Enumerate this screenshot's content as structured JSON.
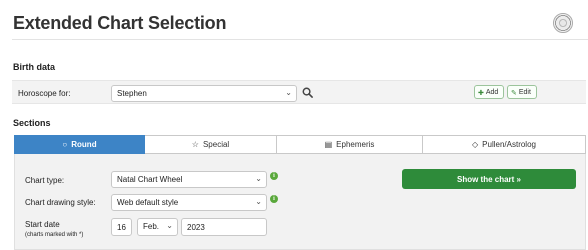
{
  "page": {
    "title": "Extended Chart Selection",
    "logo_icon": "astrodienst-logo-icon"
  },
  "birth_data": {
    "heading": "Birth data",
    "horoscope_label": "Horoscope for:",
    "horoscope_value": "Stephen",
    "add_label": "Add",
    "edit_label": "Edit"
  },
  "sections": {
    "heading": "Sections",
    "tabs": [
      {
        "label": "Round",
        "icon": "circle-icon",
        "glyph": "○",
        "active": true
      },
      {
        "label": "Special",
        "icon": "star-icon",
        "glyph": "☆",
        "active": false
      },
      {
        "label": "Ephemeris",
        "icon": "document-icon",
        "glyph": "▤",
        "active": false
      },
      {
        "label": "Pullen/Astrolog",
        "icon": "diamond-icon",
        "glyph": "◇",
        "active": false
      }
    ]
  },
  "form": {
    "chart_type_label": "Chart type:",
    "chart_type_value": "Natal Chart Wheel",
    "drawing_style_label": "Chart drawing style:",
    "drawing_style_value": "Web default style",
    "start_date_label": "Start date",
    "start_date_note": "(charts marked with *)",
    "day_value": "16",
    "month_value": "Feb.",
    "year_value": "2023",
    "info_glyph": "i",
    "show_chart_label": "Show the chart »"
  },
  "colors": {
    "accent_blue": "#3d84c6",
    "primary_green": "#2e8b3a",
    "info_green": "#5aa83c"
  }
}
